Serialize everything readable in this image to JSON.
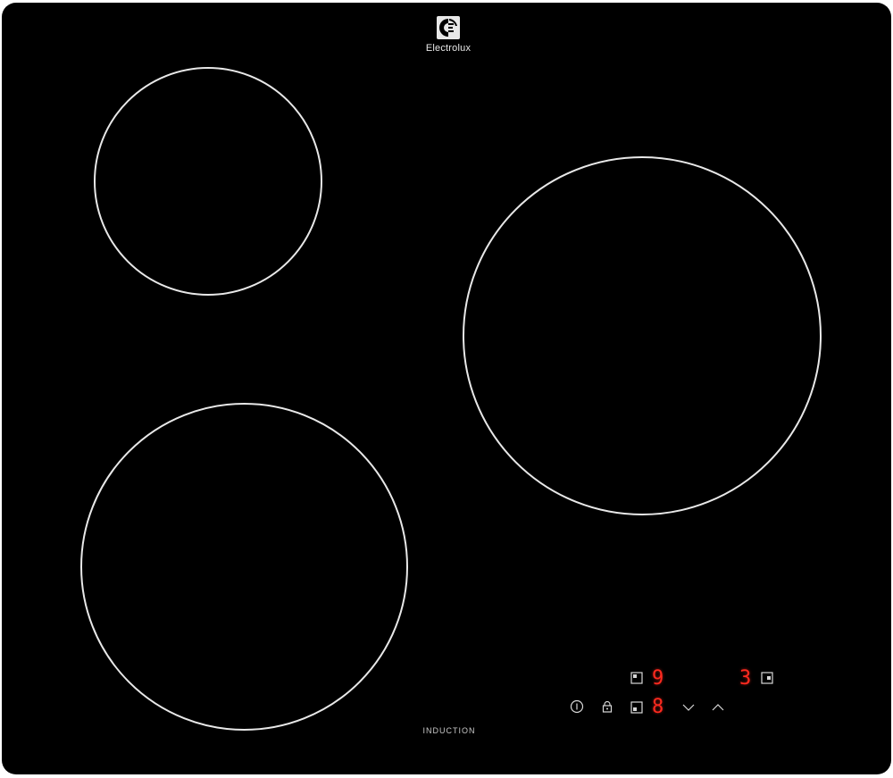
{
  "brand": {
    "name": "Electrolux",
    "logo_icon": "electrolux-logo-icon"
  },
  "hob": {
    "label": "INDUCTION",
    "surface_color": "#000000",
    "zone_outline_color": "#e8e8e8"
  },
  "cooking_zones": [
    {
      "name": "zone-top-left"
    },
    {
      "name": "zone-right"
    },
    {
      "name": "zone-bottom-left"
    }
  ],
  "control_panel": {
    "display_color": "#ff2a1f",
    "displays": {
      "rear_left": "9",
      "rear_right": "3",
      "front_left": "8"
    },
    "icons": {
      "power": "power-icon",
      "lock": "lock-icon",
      "minus": "chevron-down-icon",
      "plus": "chevron-up-icon",
      "zone_select": "zone-select-icon"
    }
  }
}
